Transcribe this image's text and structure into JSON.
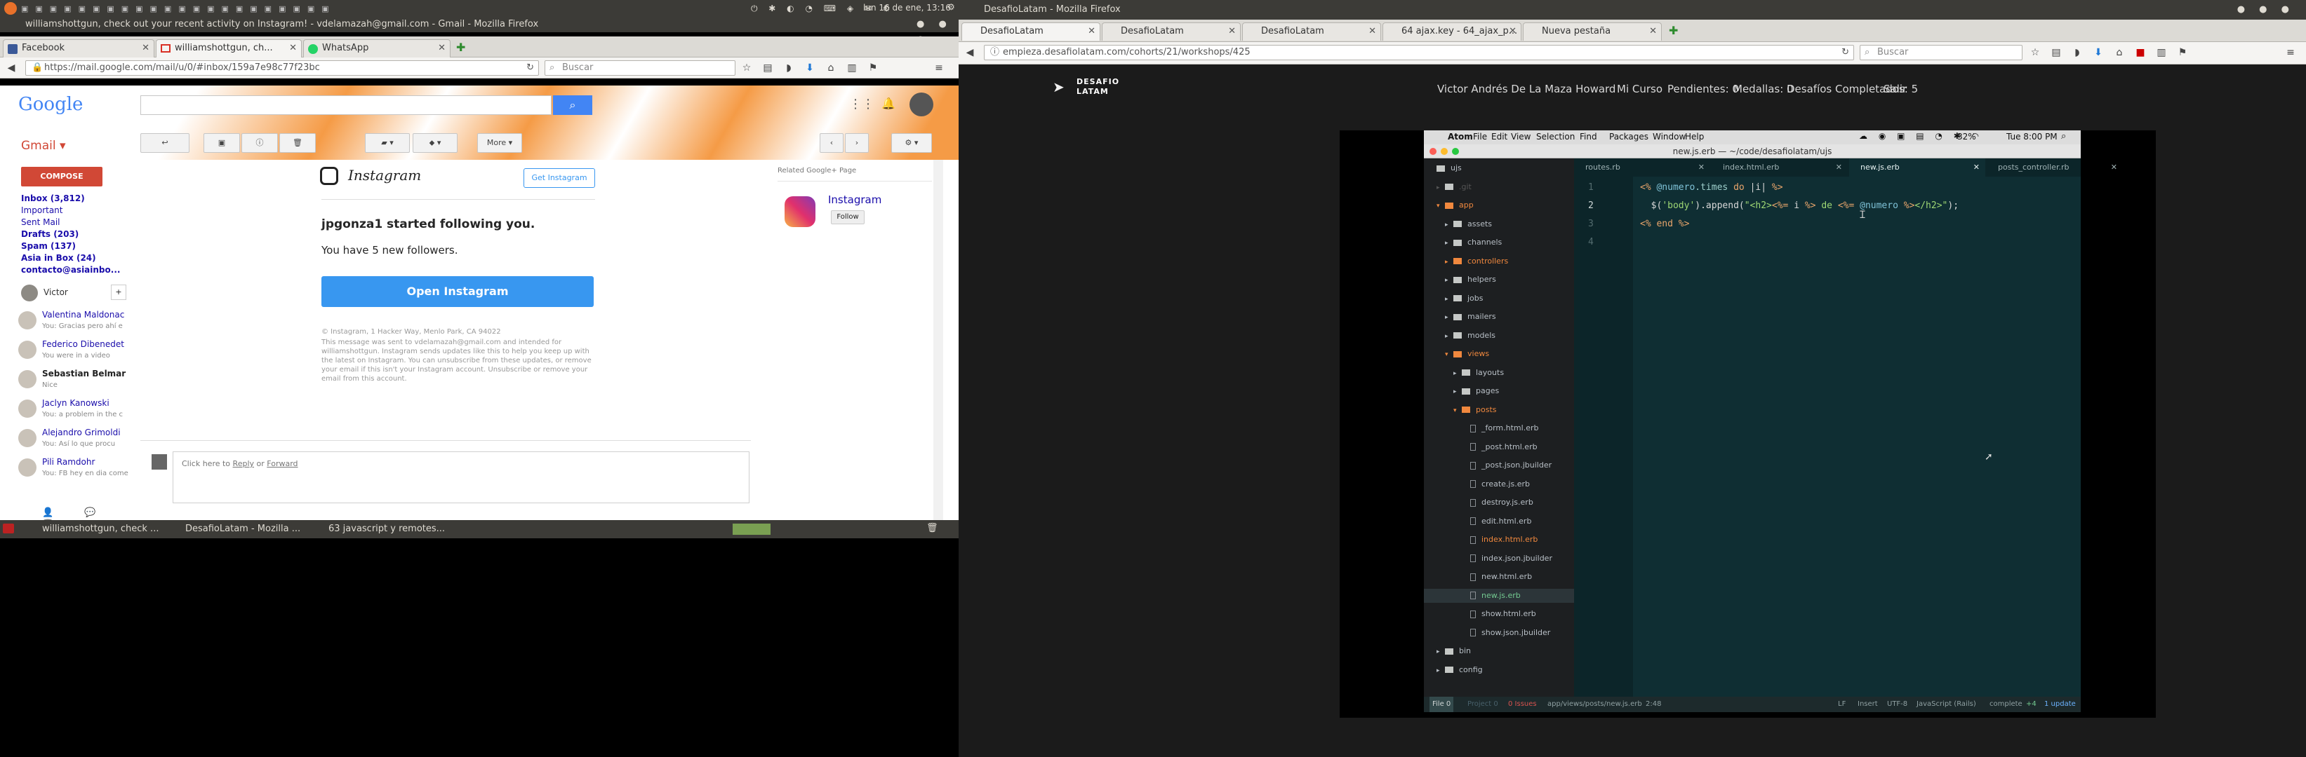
{
  "left": {
    "topbar": {
      "clock": "lun 16 de ene, 13:16"
    },
    "window_title": "williamshottgun, check out your recent activity on Instagram! - vdelamazah@gmail.com - Gmail - Mozilla Firefox",
    "tabs": [
      {
        "label": "Facebook"
      },
      {
        "label": "williamshottgun, ch..."
      },
      {
        "label": "WhatsApp"
      }
    ],
    "url": "https://mail.google.com/mail/u/0/#inbox/159a7e98c77f23bc",
    "search_placeholder": "Buscar",
    "gmail": {
      "logo": "Google",
      "label_title": "Gmail",
      "compose": "COMPOSE",
      "more": "More",
      "labels": [
        {
          "text": "Inbox (3,812)",
          "bold": true
        },
        {
          "text": "Important",
          "bold": false
        },
        {
          "text": "Sent Mail",
          "bold": false
        },
        {
          "text": "Drafts (203)",
          "bold": true
        },
        {
          "text": "Spam (137)",
          "bold": true
        },
        {
          "text": "Asia in Box (24)",
          "bold": true
        },
        {
          "text": "contacto@asiainbo...",
          "bold": true
        }
      ],
      "me": "Victor",
      "chats": [
        {
          "name": "Valentina Maldonac",
          "sub": "You: Gracias pero ahí e",
          "bold": false
        },
        {
          "name": "Federico Dibenedet",
          "sub": "You were in a video",
          "bold": false
        },
        {
          "name": "Sebastian Belmar",
          "sub": "Nice",
          "bold": true
        },
        {
          "name": "Jaclyn Kanowski",
          "sub": "You: a problem in the c",
          "bold": false
        },
        {
          "name": "Alejandro Grimoldi",
          "sub": "You: Así lo que procu",
          "bold": false
        },
        {
          "name": "Pili Ramdohr",
          "sub": "You: FB hey en dia come",
          "bold": false
        }
      ],
      "email": {
        "brand": "Instagram",
        "get_app": "Get Instagram",
        "headline": "jpgonza1 started following you.",
        "sub": "You have 5 new followers.",
        "cta": "Open Instagram",
        "footer1": "© Instagram, 1 Hacker Way, Menlo Park, CA 94022",
        "footer2": "This message was sent to vdelamazah@gmail.com and intended for williamshottgun. Instagram sends updates like this to help you keep up with the latest on Instagram. You can unsubscribe from these updates, or remove your email if this isn't your Instagram account. Unsubscribe or remove your email from this account.",
        "reply_prefix": "Click here to",
        "reply": "Reply",
        "or": "or",
        "forward": "Forward"
      },
      "related": {
        "title": "Related Google+ Page",
        "name": "Instagram",
        "follow": "Follow"
      }
    },
    "taskbar": [
      {
        "label": "williamshottgun, check ..."
      },
      {
        "label": "DesafioLatam - Mozilla ..."
      },
      {
        "label": "63 javascript y remotes..."
      }
    ]
  },
  "right": {
    "window_title": "DesafioLatam - Mozilla Firefox",
    "tabs": [
      {
        "label": "DesafioLatam"
      },
      {
        "label": "DesafioLatam"
      },
      {
        "label": "DesafioLatam"
      },
      {
        "label": "64 ajax.key - 64_ajax_p..."
      },
      {
        "label": "Nueva pestaña"
      }
    ],
    "url": "empieza.desafiolatam.com/cohorts/21/workshops/425",
    "search_placeholder": "Buscar",
    "site": {
      "logo_line1": "DESAFIO",
      "logo_line2": "LATAM",
      "nav": [
        "Victor Andrés De La Maza Howard",
        "Mi Curso",
        "Pendientes: 0",
        "Medallas: 0",
        "Desafíos Completados: 5",
        "Salir"
      ]
    },
    "atom": {
      "menu": [
        "Atom",
        "File",
        "Edit",
        "View",
        "Selection",
        "Find",
        "Packages",
        "Window",
        "Help"
      ],
      "battery": "32%",
      "clock": "Tue 8:00 PM",
      "title": "new.js.erb — ~/code/desafiolatam/ujs",
      "tabs": [
        "routes.rb",
        "index.html.erb",
        "new.js.erb",
        "posts_controller.rb"
      ],
      "active_tab": 2,
      "tree": [
        {
          "name": "ujs",
          "depth": 0,
          "kind": "root"
        },
        {
          "name": ".git",
          "depth": 1,
          "kind": "folder",
          "dim": true
        },
        {
          "name": "app",
          "depth": 1,
          "kind": "folder",
          "open": true,
          "color": "#f0883e"
        },
        {
          "name": "assets",
          "depth": 2,
          "kind": "folder"
        },
        {
          "name": "channels",
          "depth": 2,
          "kind": "folder"
        },
        {
          "name": "controllers",
          "depth": 2,
          "kind": "folder",
          "color": "#f0883e"
        },
        {
          "name": "helpers",
          "depth": 2,
          "kind": "folder"
        },
        {
          "name": "jobs",
          "depth": 2,
          "kind": "folder"
        },
        {
          "name": "mailers",
          "depth": 2,
          "kind": "folder"
        },
        {
          "name": "models",
          "depth": 2,
          "kind": "folder"
        },
        {
          "name": "views",
          "depth": 2,
          "kind": "folder",
          "open": true,
          "color": "#f0883e"
        },
        {
          "name": "layouts",
          "depth": 3,
          "kind": "folder"
        },
        {
          "name": "pages",
          "depth": 3,
          "kind": "folder"
        },
        {
          "name": "posts",
          "depth": 3,
          "kind": "folder",
          "open": true,
          "color": "#f0883e"
        },
        {
          "name": "_form.html.erb",
          "depth": 4,
          "kind": "file"
        },
        {
          "name": "_post.html.erb",
          "depth": 4,
          "kind": "file"
        },
        {
          "name": "_post.json.jbuilder",
          "depth": 4,
          "kind": "file"
        },
        {
          "name": "create.js.erb",
          "depth": 4,
          "kind": "file"
        },
        {
          "name": "destroy.js.erb",
          "depth": 4,
          "kind": "file"
        },
        {
          "name": "edit.html.erb",
          "depth": 4,
          "kind": "file"
        },
        {
          "name": "index.html.erb",
          "depth": 4,
          "kind": "file",
          "color": "#f0883e"
        },
        {
          "name": "index.json.jbuilder",
          "depth": 4,
          "kind": "file"
        },
        {
          "name": "new.html.erb",
          "depth": 4,
          "kind": "file"
        },
        {
          "name": "new.js.erb",
          "depth": 4,
          "kind": "file",
          "color": "#73c990",
          "selected": true
        },
        {
          "name": "show.html.erb",
          "depth": 4,
          "kind": "file"
        },
        {
          "name": "show.json.jbuilder",
          "depth": 4,
          "kind": "file"
        },
        {
          "name": "bin",
          "depth": 1,
          "kind": "folder"
        },
        {
          "name": "config",
          "depth": 1,
          "kind": "folder"
        }
      ],
      "code_lines": [
        {
          "num": "1",
          "segments": [
            [
              "<% ",
              "#e9a56b"
            ],
            [
              "@numero",
              "#7fc3d8"
            ],
            [
              ".times ",
              "#9fd0cc"
            ],
            [
              "do ",
              "#e9a56b"
            ],
            [
              "|i| ",
              "#d8d8d8"
            ],
            [
              "%>",
              "#e9a56b"
            ]
          ]
        },
        {
          "num": "2",
          "segments": [
            [
              "  $(",
              "#d8d8d8"
            ],
            [
              "'body'",
              "#9ed774"
            ],
            [
              ").append(",
              "#d8d8d8"
            ],
            [
              "\"<h2>",
              "#9ed774"
            ],
            [
              "<%= ",
              "#e9a56b"
            ],
            [
              "i ",
              "#d8d8d8"
            ],
            [
              "%>",
              "#e9a56b"
            ],
            [
              " de ",
              "#9ed774"
            ],
            [
              "<%= ",
              "#e9a56b"
            ],
            [
              "@numero ",
              "#7fc3d8"
            ],
            [
              "%>",
              "#e9a56b"
            ],
            [
              "</h2>\"",
              "#9ed774"
            ],
            [
              ");",
              "#d8d8d8"
            ]
          ]
        },
        {
          "num": "3",
          "segments": [
            [
              "<% ",
              "#e9a56b"
            ],
            [
              "end ",
              "#e9a56b"
            ],
            [
              "%>",
              "#e9a56b"
            ]
          ]
        },
        {
          "num": "4",
          "segments": []
        }
      ],
      "status": {
        "file": "File 0",
        "project": "Project 0",
        "issues": "0 Issues",
        "path": "app/views/posts/new.js.erb",
        "cursor": "2:48",
        "eol": "LF",
        "mode": "Insert",
        "encoding": "UTF-8",
        "grammar": "JavaScript (Rails)",
        "complete": "complete",
        "git": "+4",
        "update": "1 update"
      }
    }
  }
}
